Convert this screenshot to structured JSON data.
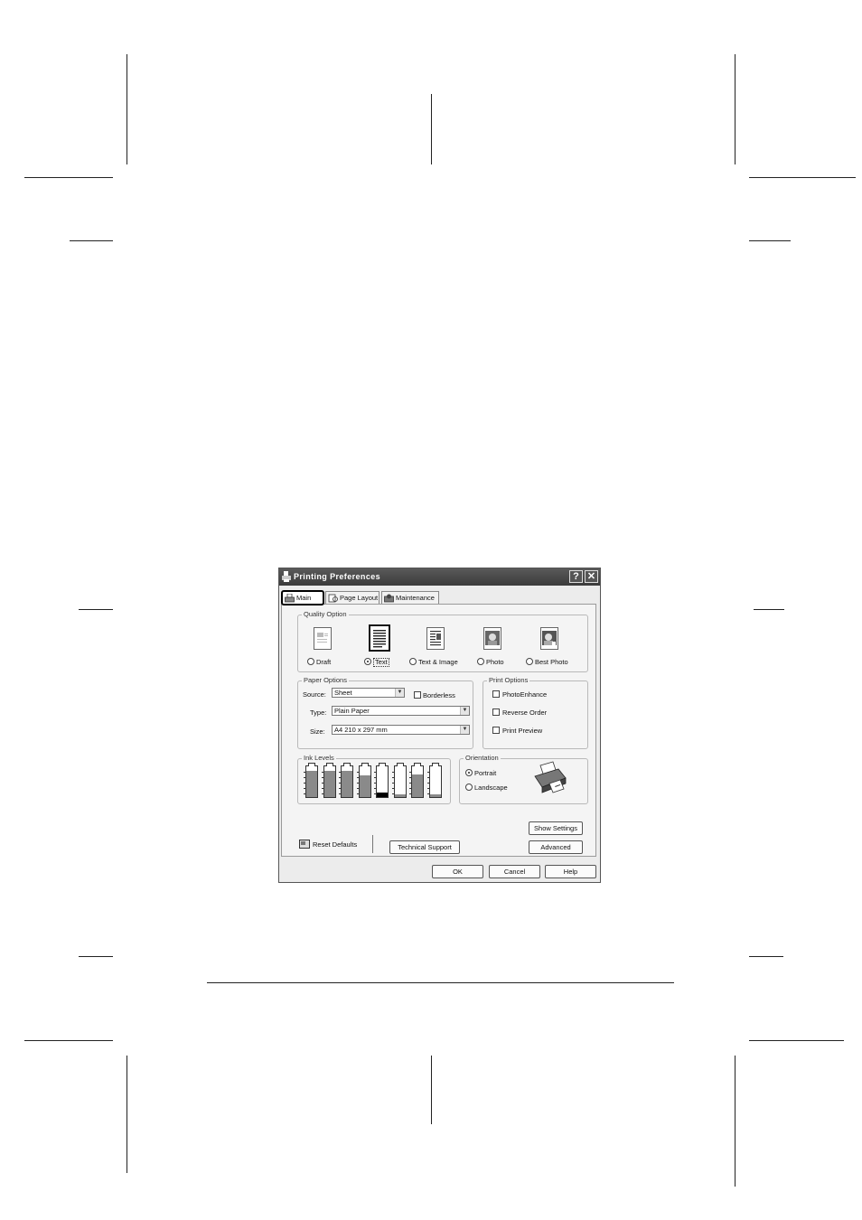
{
  "dialog": {
    "title": "Printing Preferences",
    "help_glyph": "?",
    "close_glyph": "✕",
    "title_icon": "printer-icon",
    "tabs": [
      {
        "label": "Main",
        "icon": "printer-icon"
      },
      {
        "label": "Page Layout",
        "icon": "page-layout-icon"
      },
      {
        "label": "Maintenance",
        "icon": "maintenance-icon"
      }
    ],
    "quality_option": {
      "label": "Quality Option",
      "options": [
        {
          "label": "Draft",
          "icon": "draft-icon"
        },
        {
          "label": "Text",
          "icon": "text-icon",
          "selected": true
        },
        {
          "label": "Text & Image",
          "icon": "text-image-icon"
        },
        {
          "label": "Photo",
          "icon": "photo-icon"
        },
        {
          "label": "Best Photo",
          "icon": "best-photo-icon"
        }
      ]
    },
    "paper_options": {
      "label": "Paper Options",
      "source_label": "Source:",
      "source_value": "Sheet",
      "borderless_label": "Borderless",
      "type_label": "Type:",
      "type_value": "Plain Paper",
      "size_label": "Size:",
      "size_value": "A4 210 x 297 mm"
    },
    "print_options": {
      "label": "Print Options",
      "items": [
        "PhotoEnhance",
        "Reverse Order",
        "Print Preview"
      ]
    },
    "ink_levels": {
      "label": "Ink Levels",
      "levels": [
        0.85,
        0.85,
        0.85,
        0.7,
        0.15,
        0.1,
        0.75,
        0.1
      ],
      "dark_cartridge_index": 4
    },
    "orientation": {
      "label": "Orientation",
      "portrait": "Portrait",
      "landscape": "Landscape",
      "selected": "Portrait",
      "icon": "printer-illustration-icon"
    },
    "buttons": {
      "reset_defaults": "Reset Defaults",
      "technical_support": "Technical Support",
      "show_settings": "Show Settings",
      "advanced": "Advanced",
      "ok": "OK",
      "cancel": "Cancel",
      "help": "Help"
    }
  }
}
